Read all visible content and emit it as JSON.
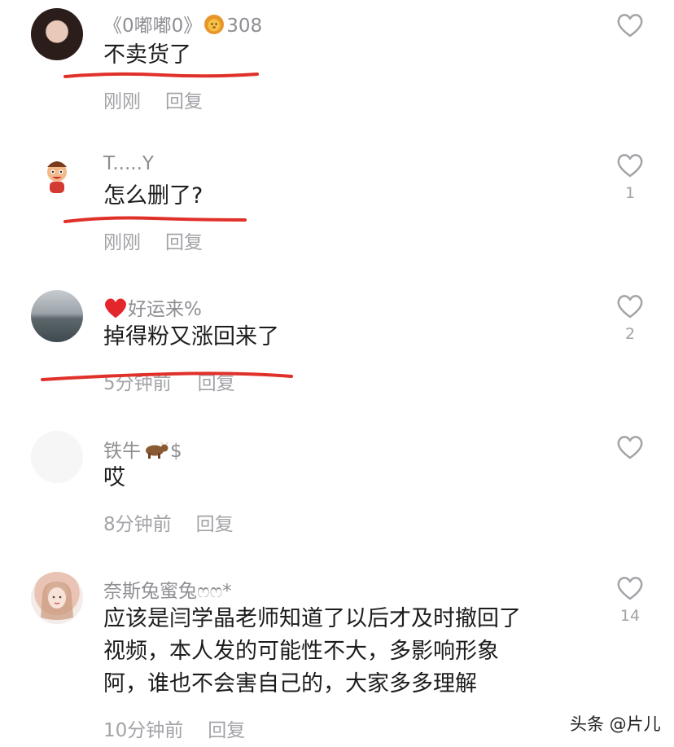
{
  "comments": [
    {
      "username": "《0嘟嘟0》",
      "badge_icon": "lion-icon",
      "badge_count": "308",
      "text": "不卖货了",
      "time": "刚刚",
      "reply_label": "回复",
      "likes": ""
    },
    {
      "username": "T.....Y",
      "text": "怎么删了?",
      "time": "刚刚",
      "reply_label": "回复",
      "likes": "1"
    },
    {
      "username_prefix_icon": "red-heart-icon",
      "username": "好运来%",
      "text": "掉得粉又涨回来了",
      "time": "5分钟前",
      "reply_label": "回复",
      "likes": "2"
    },
    {
      "username": "铁牛",
      "username_suffix_icon": "ox-icon",
      "username_suffix": "$",
      "text": "哎",
      "time": "8分钟前",
      "reply_label": "回复",
      "likes": ""
    },
    {
      "username": "奈斯兔蜜兔ෆෆ*",
      "text_lines": [
        "应该是闫学晶老师知道了以后才及时撤回了",
        "视频，本人发的可能性不大，多影响形象",
        "阿，谁也不会害自己的，大家多多理解"
      ],
      "time": "10分钟前",
      "reply_label": "回复",
      "likes": "14"
    }
  ],
  "watermark": "头条 @片儿",
  "colors": {
    "annotation_red": "#e0302a",
    "meta_gray": "#a3a3a8",
    "text": "#1c1c1e"
  }
}
